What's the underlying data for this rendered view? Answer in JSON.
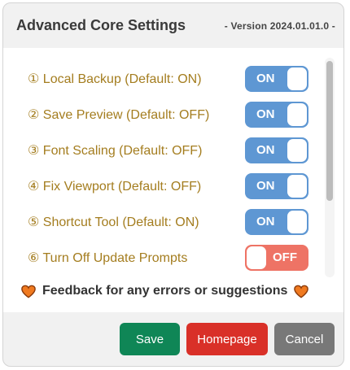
{
  "header": {
    "title": "Advanced Core Settings",
    "version": "- Version 2024.01.01.0 -"
  },
  "settings": [
    {
      "label": "① Local Backup (Default: ON)",
      "state": "ON"
    },
    {
      "label": "② Save Preview (Default: OFF)",
      "state": "ON"
    },
    {
      "label": "③ Font Scaling (Default: OFF)",
      "state": "ON"
    },
    {
      "label": "④ Fix Viewport (Default: OFF)",
      "state": "ON"
    },
    {
      "label": "⑤ Shortcut Tool (Default: ON)",
      "state": "ON"
    },
    {
      "label": "⑥ Turn Off Update Prompts",
      "state": "OFF"
    }
  ],
  "feedback": {
    "text": "Feedback for any errors or suggestions",
    "icon": "heart-icon"
  },
  "buttons": {
    "save": "Save",
    "homepage": "Homepage",
    "cancel": "Cancel"
  },
  "colors": {
    "label_text": "#a47d1f",
    "toggle_on": "#5e97d3",
    "toggle_off": "#ee7365",
    "save": "#0f8656",
    "homepage": "#d93028",
    "cancel": "#787878",
    "heart": "#f07a20"
  }
}
